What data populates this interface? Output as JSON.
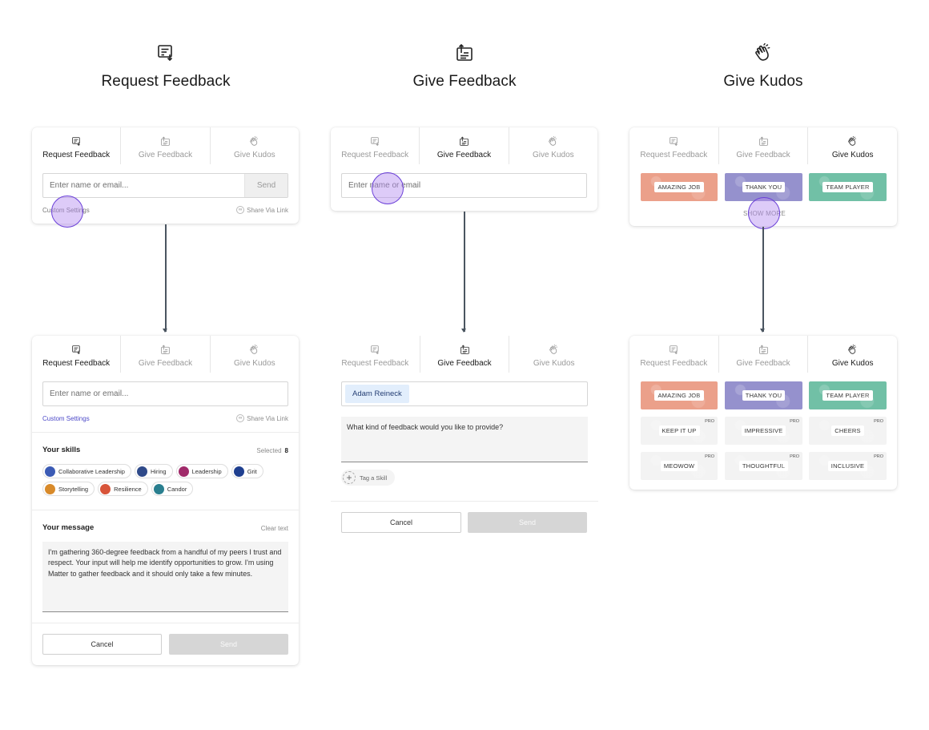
{
  "columns": {
    "request": {
      "title": "Request Feedback",
      "icon": "request-feedback-icon"
    },
    "give": {
      "title": "Give Feedback",
      "icon": "give-feedback-icon"
    },
    "kudos": {
      "title": "Give Kudos",
      "icon": "clapping-hands-icon"
    }
  },
  "tabs": {
    "request": "Request Feedback",
    "give": "Give Feedback",
    "kudos": "Give Kudos"
  },
  "request_card": {
    "input_placeholder": "Enter name or email...",
    "send_label": "Send",
    "custom_settings": "Custom Settings",
    "share_via_link": "Share Via Link"
  },
  "request_expanded": {
    "input_placeholder": "Enter name or email...",
    "custom_settings": "Custom Settings",
    "share_via_link": "Share Via Link",
    "skills_title": "Your skills",
    "skills_selected_label": "Selected",
    "skills_selected_count": "8",
    "skills": [
      {
        "label": "Collaborative Leadership",
        "color": "#3b5bb5"
      },
      {
        "label": "Hiring",
        "color": "#2f4a8a"
      },
      {
        "label": "Leadership",
        "color": "#a02a6a"
      },
      {
        "label": "Grit",
        "color": "#1f3f8f"
      },
      {
        "label": "Storytelling",
        "color": "#d88a2a"
      },
      {
        "label": "Resilience",
        "color": "#d8553a"
      },
      {
        "label": "Candor",
        "color": "#2a7f8f"
      }
    ],
    "message_title": "Your message",
    "clear_text": "Clear text",
    "message": "I'm gathering 360-degree feedback from a handful of my peers I trust and respect. Your input will help me identify opportunities to grow. I'm using Matter to gather feedback and it should only take a few minutes.",
    "cancel_label": "Cancel",
    "send_label": "Send"
  },
  "give_card": {
    "input_placeholder": "Enter name or email"
  },
  "give_expanded": {
    "recipient": "Adam Reineck",
    "feedback_placeholder": "What kind of feedback would you like to provide?",
    "tag_skill": "Tag a Skill",
    "cancel_label": "Cancel",
    "send_label": "Send"
  },
  "kudos_card": {
    "items": [
      "AMAZING JOB",
      "THANK YOU",
      "TEAM PLAYER"
    ],
    "show_more": "SHOW MORE"
  },
  "kudos_expanded": {
    "items": [
      "AMAZING JOB",
      "THANK YOU",
      "TEAM PLAYER",
      "KEEP IT UP",
      "IMPRESSIVE",
      "CHEERS",
      "MEOWOW",
      "THOUGHTFUL",
      "INCLUSIVE"
    ],
    "pro_label": "PRO"
  },
  "colors": {
    "accent": "#4c49c8",
    "kudos_orange": "#eba08a",
    "kudos_purple": "#9591cd",
    "kudos_green": "#71c0a6",
    "connector": "#4a5560",
    "highlight": "#6a3fd8"
  }
}
